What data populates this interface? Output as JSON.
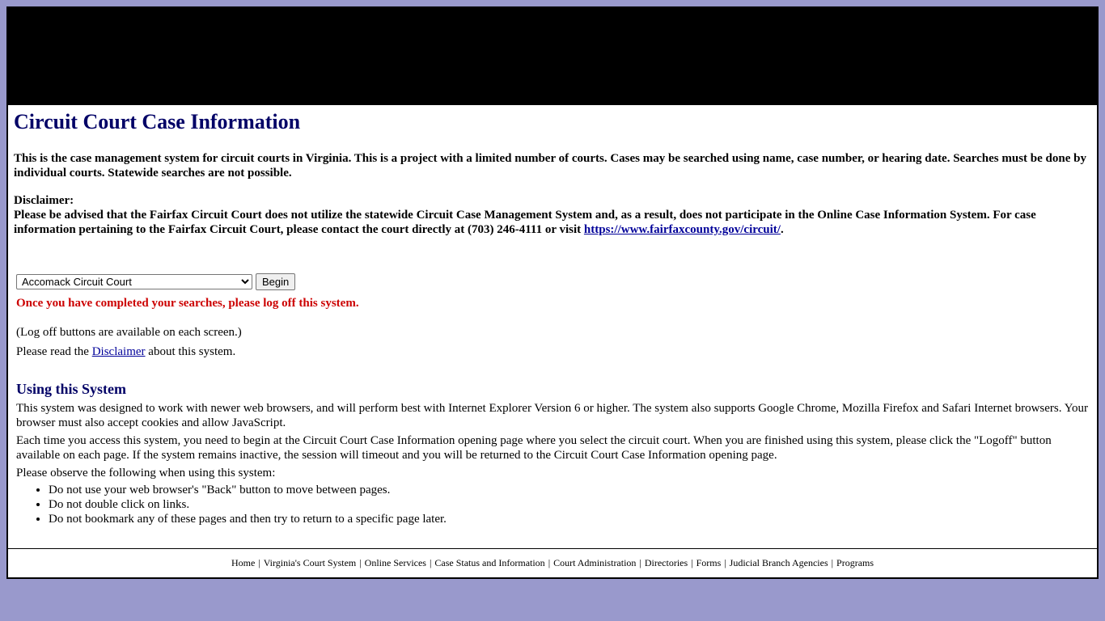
{
  "page": {
    "title": "Circuit Court Case Information",
    "intro": "This is the case management system for circuit courts in Virginia. This is a project with a limited number of courts. Cases may be searched using name, case number, or hearing date. Searches must be done by individual courts. Statewide searches are not possible."
  },
  "disclaimer": {
    "heading": "Disclaimer:",
    "text_before_link": "Please be advised that the Fairfax Circuit Court does not utilize the statewide Circuit Case Management System and, as a result, does not participate in the Online Case Information System. For case information pertaining to the Fairfax Circuit Court, please contact the court directly at (703) 246-4111 or visit ",
    "link_text": "https://www.fairfaxcounty.gov/circuit/",
    "text_after_link": "."
  },
  "court_selector": {
    "selected": "Accomack Circuit Court",
    "begin_label": "Begin"
  },
  "notices": {
    "logoff_warning": "Once you have completed your searches, please log off this system.",
    "logoff_buttons_note": "(Log off buttons are available on each screen.)",
    "read_prefix": "Please read the ",
    "read_link": "Disclaimer",
    "read_suffix": " about this system."
  },
  "using_system": {
    "heading": "Using this System",
    "para1": "This system was designed to work with newer web browsers, and will perform best with Internet Explorer Version 6 or higher. The system also supports Google Chrome, Mozilla Firefox and Safari Internet browsers. Your browser must also accept cookies and allow JavaScript.",
    "para2": "Each time you access this system, you need to begin at the Circuit Court Case Information opening page where you select the circuit court. When you are finished using this system, please click the \"Logoff\" button available on each page. If the system remains inactive, the session will timeout and you will be returned to the Circuit Court Case Information opening page.",
    "para3": "Please observe the following when using this system:",
    "rules": [
      "Do not use your web browser's \"Back\" button to move between pages.",
      "Do not double click on links.",
      "Do not bookmark any of these pages and then try to return to a specific page later."
    ]
  },
  "footer": {
    "links": [
      "Home",
      "Virginia's Court System",
      "Online Services",
      "Case Status and Information",
      "Court Administration",
      "Directories",
      "Forms",
      "Judicial Branch Agencies",
      "Programs"
    ],
    "separator": "|"
  },
  "colors": {
    "page_background": "#9999cc",
    "banner": "#000000",
    "heading": "#000066",
    "warning": "#cc0000",
    "link": "#000099"
  }
}
